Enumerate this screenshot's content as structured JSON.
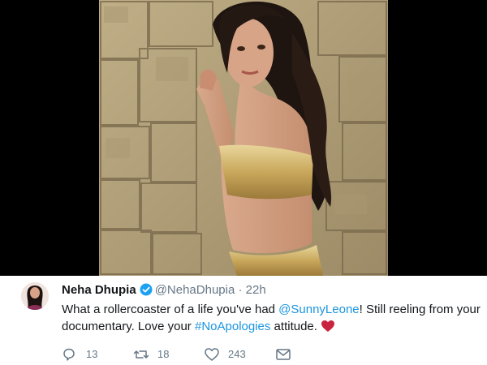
{
  "tweet": {
    "name": "Neha Dhupia",
    "handle": "@NehaDhupia",
    "separator": "·",
    "time": "22h",
    "text_1": "What a rollercoaster of a life you've had ",
    "mention": "@SunnyLeone",
    "text_2": "! Still reeling from your documentary. Love your ",
    "hashtag": "#NoApologies",
    "text_3": " attitude.",
    "reply_count": "13",
    "retweet_count": "18",
    "like_count": "243"
  },
  "colors": {
    "link": "#1b95e0",
    "verified": "#1da1f2",
    "heart": "#c9243f",
    "text": "#14171a",
    "muted": "#657786"
  },
  "icons": [
    "verified-badge-icon",
    "red-heart-icon",
    "reply-icon",
    "retweet-icon",
    "like-icon",
    "direct-message-icon"
  ]
}
